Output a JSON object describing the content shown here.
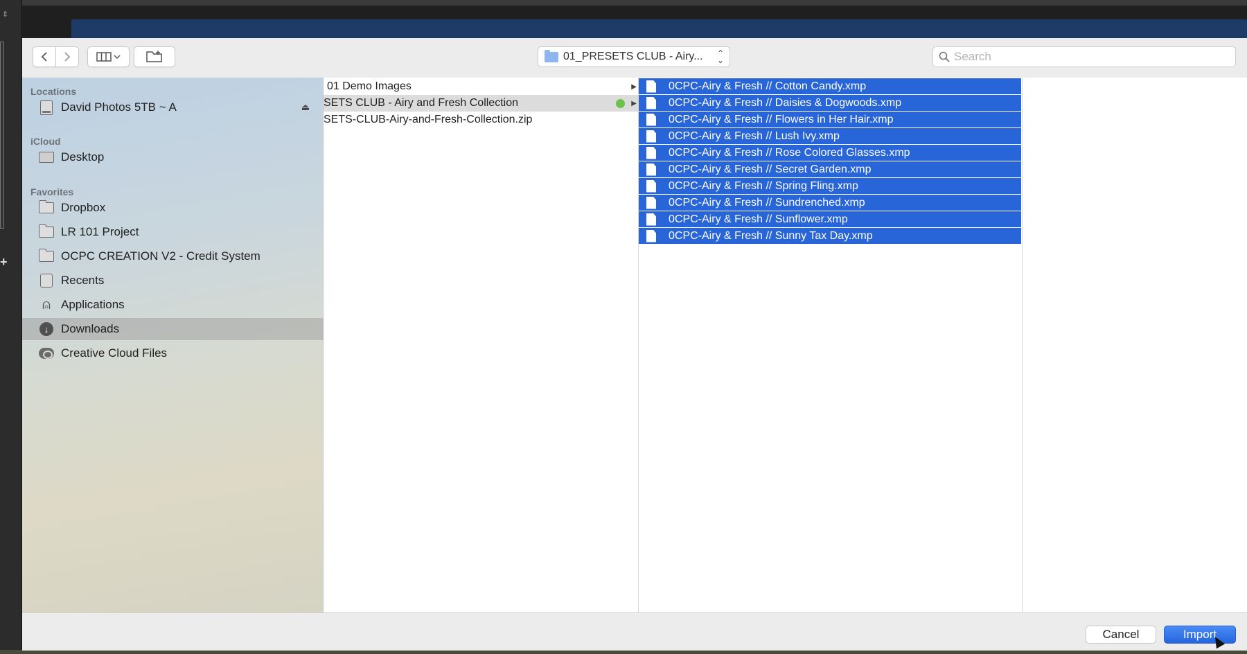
{
  "toolbar": {
    "path_label": "01_PRESETS CLUB - Airy...",
    "search_placeholder": "Search"
  },
  "sidebar": {
    "sections": [
      {
        "title": "Locations",
        "items": [
          {
            "label": "David Photos 5TB ~ A",
            "icon": "disk-icon"
          }
        ]
      },
      {
        "title": "iCloud",
        "items": [
          {
            "label": "Desktop",
            "icon": "desktop-icon"
          }
        ]
      },
      {
        "title": "Favorites",
        "items": [
          {
            "label": "Dropbox",
            "icon": "folder-icon"
          },
          {
            "label": "LR 101 Project",
            "icon": "folder-icon"
          },
          {
            "label": "OCPC CREATION V2 - Credit System",
            "icon": "folder-icon"
          },
          {
            "label": "Recents",
            "icon": "recents-icon"
          },
          {
            "label": "Applications",
            "icon": "applications-icon"
          },
          {
            "label": "Downloads",
            "icon": "downloads-icon",
            "selected": true
          },
          {
            "label": "Creative Cloud Files",
            "icon": "creative-cloud-icon"
          }
        ]
      }
    ]
  },
  "column1": {
    "items": [
      {
        "label": "01 Demo Images",
        "has_children": true
      },
      {
        "label": "SETS CLUB - Airy and Fresh Collection",
        "has_children": true,
        "selected": true,
        "tag_color": "#6cc24a"
      },
      {
        "label": "SETS-CLUB-Airy-and-Fresh-Collection.zip",
        "has_children": false
      }
    ]
  },
  "column2": {
    "items": [
      "0CPC-Airy & Fresh // Cotton Candy.xmp",
      "0CPC-Airy & Fresh // Daisies & Dogwoods.xmp",
      "0CPC-Airy & Fresh // Flowers in Her Hair.xmp",
      "0CPC-Airy & Fresh // Lush Ivy.xmp",
      "0CPC-Airy & Fresh // Rose Colored Glasses.xmp",
      "0CPC-Airy & Fresh // Secret Garden.xmp",
      "0CPC-Airy & Fresh // Spring Fling.xmp",
      "0CPC-Airy & Fresh // Sundrenched.xmp",
      "0CPC-Airy & Fresh // Sunflower.xmp",
      "0CPC-Airy & Fresh // Sunny Tax Day.xmp"
    ]
  },
  "buttons": {
    "cancel": "Cancel",
    "import": "Import"
  },
  "colors": {
    "selection": "#2765d8",
    "accent_button": "#2566e0"
  }
}
